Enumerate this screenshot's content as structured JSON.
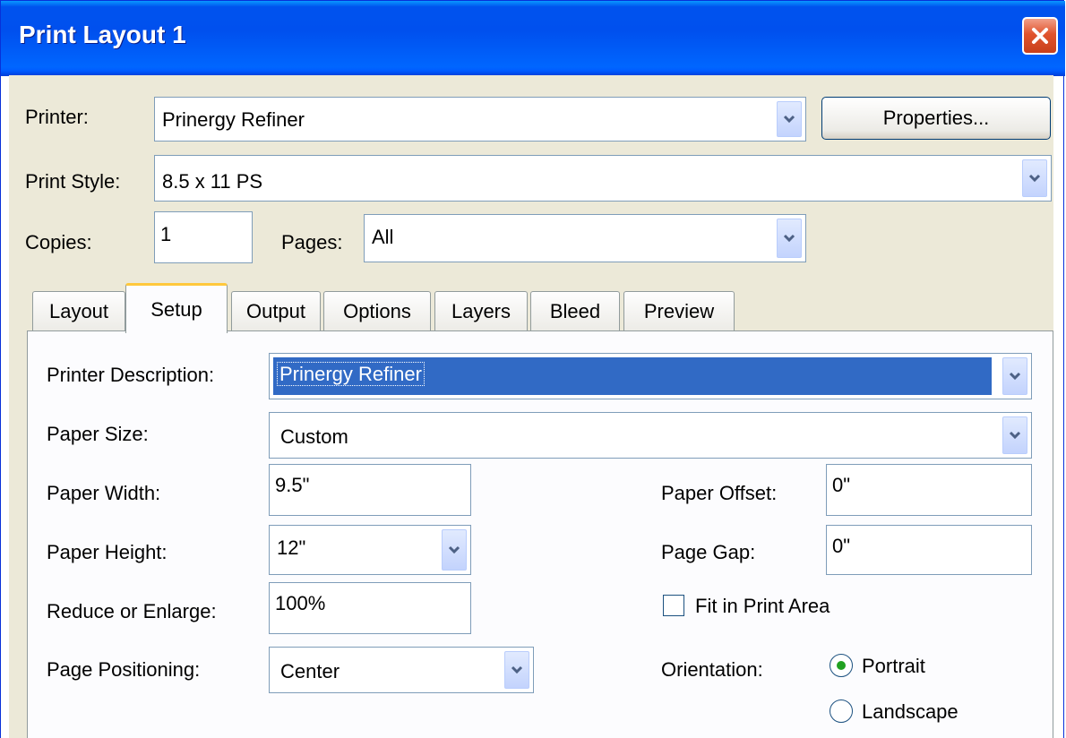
{
  "window": {
    "title": "Print Layout 1"
  },
  "printer": {
    "label": "Printer:",
    "value": "Prinergy Refiner",
    "properties_label": "Properties..."
  },
  "print_style": {
    "label": "Print Style:",
    "value": "8.5 x 11 PS"
  },
  "copies": {
    "label": "Copies:",
    "value": "1"
  },
  "pages": {
    "label": "Pages:",
    "value": "All"
  },
  "tabs": [
    {
      "label": "Layout"
    },
    {
      "label": "Setup"
    },
    {
      "label": "Output"
    },
    {
      "label": "Options"
    },
    {
      "label": "Layers"
    },
    {
      "label": "Bleed"
    },
    {
      "label": "Preview"
    }
  ],
  "active_tab": "Setup",
  "setup": {
    "printer_description": {
      "label": "Printer Description:",
      "value": "Prinergy Refiner"
    },
    "paper_size": {
      "label": "Paper Size:",
      "value": "Custom"
    },
    "paper_width": {
      "label": "Paper Width:",
      "value": "9.5\""
    },
    "paper_height": {
      "label": "Paper Height:",
      "value": "12\""
    },
    "reduce_enlarge": {
      "label": "Reduce or Enlarge:",
      "value": "100%"
    },
    "page_positioning": {
      "label": "Page Positioning:",
      "value": "Center"
    },
    "paper_offset": {
      "label": "Paper Offset:",
      "value": "0\""
    },
    "page_gap": {
      "label": "Page Gap:",
      "value": "0\""
    },
    "fit_in_print_area": {
      "label": "Fit in Print Area",
      "checked": false
    },
    "orientation": {
      "label": "Orientation:",
      "options": [
        {
          "label": "Portrait",
          "selected": true
        },
        {
          "label": "Landscape",
          "selected": false
        }
      ]
    }
  },
  "colors": {
    "title_bar": "#0054e3",
    "selection": "#316ac5",
    "dialog_bg": "#ece9d8",
    "close_button": "#e0532d"
  }
}
